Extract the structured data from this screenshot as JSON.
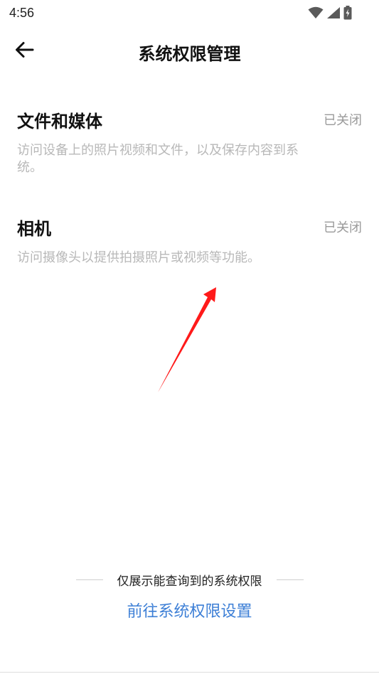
{
  "status_bar": {
    "time": "4:56",
    "icons": [
      "wifi-icon",
      "cellular-signal-icon",
      "battery-charging-icon"
    ]
  },
  "header": {
    "title": "系统权限管理",
    "back_icon": "arrow-left-icon"
  },
  "permissions": [
    {
      "name": "文件和媒体",
      "status": "已关闭",
      "description": "访问设备上的照片视频和文件，以及保存内容到系统。"
    },
    {
      "name": "相机",
      "status": "已关闭",
      "description": "访问摄像头以提供拍摄照片或视频等功能。"
    }
  ],
  "footer": {
    "note": "仅展示能查询到的系统权限",
    "link_label": "前往系统权限设置"
  },
  "colors": {
    "link": "#3d7fd6",
    "annotation_arrow": "#ff1a1a",
    "muted_text": "#9a9a9a"
  }
}
